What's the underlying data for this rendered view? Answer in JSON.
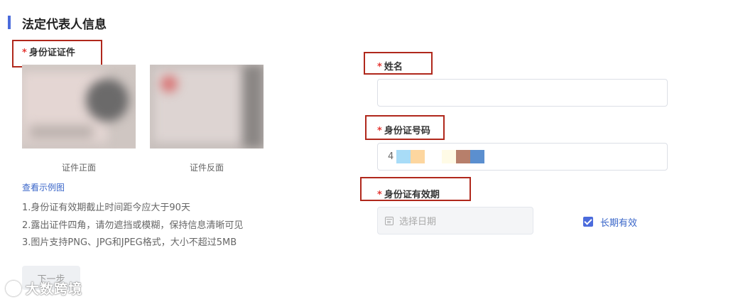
{
  "section": {
    "title": "法定代表人信息"
  },
  "id_document": {
    "label": "身份证证件",
    "front_caption": "证件正面",
    "back_caption": "证件反面",
    "example_link": "查看示例图",
    "notes": [
      "1.身份证有效期截止时间距今应大于90天",
      "2.露出证件四角，请勿遮挡或模糊，保持信息清晰可见",
      "3.图片支持PNG、JPG和JPEG格式，大小不超过5MB"
    ]
  },
  "next_button": {
    "label": "下一步"
  },
  "name_field": {
    "label": "姓名",
    "value": ""
  },
  "id_number_field": {
    "label": "身份证号码",
    "value": "4",
    "redaction_colors": [
      "#a8dcf7",
      "#fdd69f",
      "#fffbe6",
      "#b77f6b",
      "#5b8fcf"
    ]
  },
  "validity_field": {
    "label": "身份证有效期",
    "date_placeholder": "选择日期",
    "long_term_label": "长期有效",
    "long_term_checked": true
  },
  "colors": {
    "accent": "#4b6bdc",
    "required": "#e53935",
    "highlight": "#b0281c",
    "link": "#3a66c9"
  },
  "watermark": {
    "text": "大数跨境"
  }
}
